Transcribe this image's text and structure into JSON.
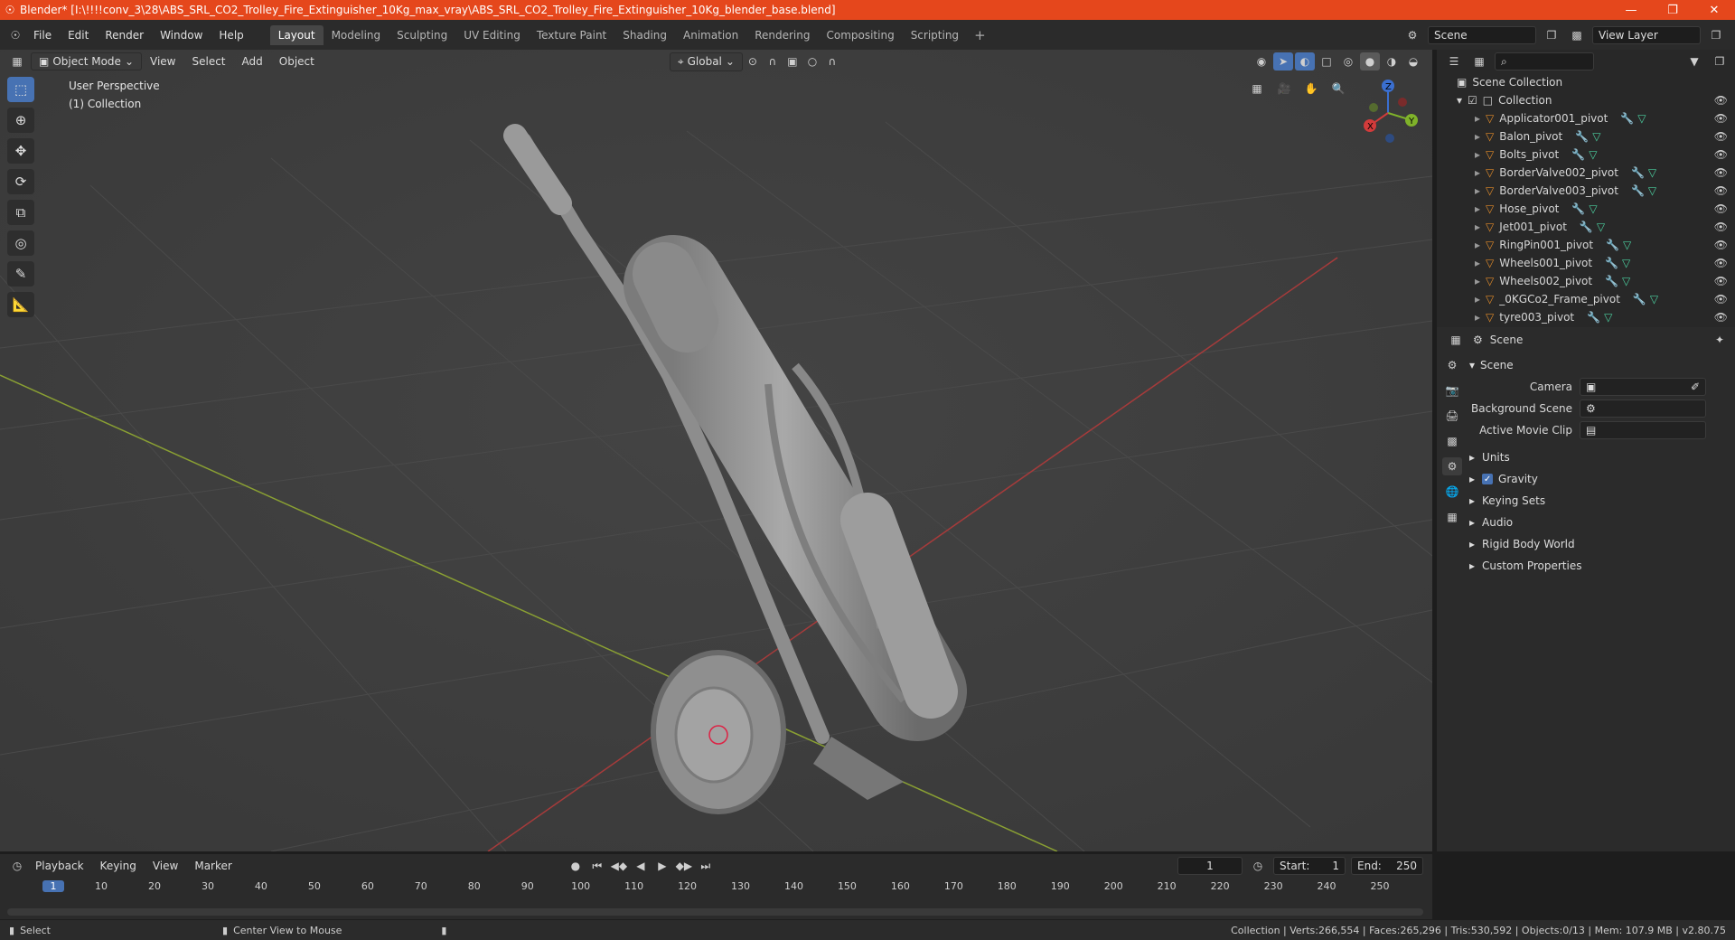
{
  "window": {
    "title": "Blender* [I:\\!!!!conv_3\\28\\ABS_SRL_CO2_Trolley_Fire_Extinguisher_10Kg_max_vray\\ABS_SRL_CO2_Trolley_Fire_Extinguisher_10Kg_blender_base.blend]",
    "controls": [
      "—",
      "❐",
      "✕"
    ]
  },
  "menu": [
    "File",
    "Edit",
    "Render",
    "Window",
    "Help"
  ],
  "workspaces": [
    "Layout",
    "Modeling",
    "Sculpting",
    "UV Editing",
    "Texture Paint",
    "Shading",
    "Animation",
    "Rendering",
    "Compositing",
    "Scripting"
  ],
  "active_workspace": "Layout",
  "scene_field": "Scene",
  "view_layer_field": "View Layer",
  "viewport": {
    "mode": "Object Mode",
    "menus": [
      "View",
      "Select",
      "Add",
      "Object"
    ],
    "orientation": "Global",
    "overlay_title": "User Perspective",
    "overlay_collection": "(1) Collection",
    "gizmo": {
      "x": "X",
      "y": "Y",
      "z": "Z"
    }
  },
  "outliner": {
    "root": "Scene Collection",
    "collection": "Collection",
    "items": [
      "Applicator001_pivot",
      "Balon_pivot",
      "Bolts_pivot",
      "BorderValve002_pivot",
      "BorderValve003_pivot",
      "Hose_pivot",
      "Jet001_pivot",
      "RingPin001_pivot",
      "Wheels001_pivot",
      "Wheels002_pivot",
      "_0KGCo2_Frame_pivot",
      "tyre003_pivot"
    ]
  },
  "properties": {
    "header": "Scene",
    "panel": "Scene",
    "camera_label": "Camera",
    "background_label": "Background Scene",
    "movieclip_label": "Active Movie Clip",
    "sections": [
      "Units",
      "Gravity",
      "Keying Sets",
      "Audio",
      "Rigid Body World",
      "Custom Properties"
    ]
  },
  "timeline": {
    "menus": [
      "Playback",
      "Keying",
      "View",
      "Marker"
    ],
    "current_frame": "1",
    "start_label": "Start:",
    "start": "1",
    "end_label": "End:",
    "end": "250",
    "ticks": [
      "1",
      "10",
      "20",
      "30",
      "40",
      "50",
      "60",
      "70",
      "80",
      "90",
      "100",
      "110",
      "120",
      "130",
      "140",
      "150",
      "160",
      "170",
      "180",
      "190",
      "200",
      "210",
      "220",
      "230",
      "240",
      "250"
    ]
  },
  "status": {
    "left1": "Select",
    "left2": "Center View to Mouse",
    "stats": "Collection | Verts:266,554 | Faces:265,296 | Tris:530,592 | Objects:0/13 | Mem: 107.9 MB | v2.80.75"
  }
}
